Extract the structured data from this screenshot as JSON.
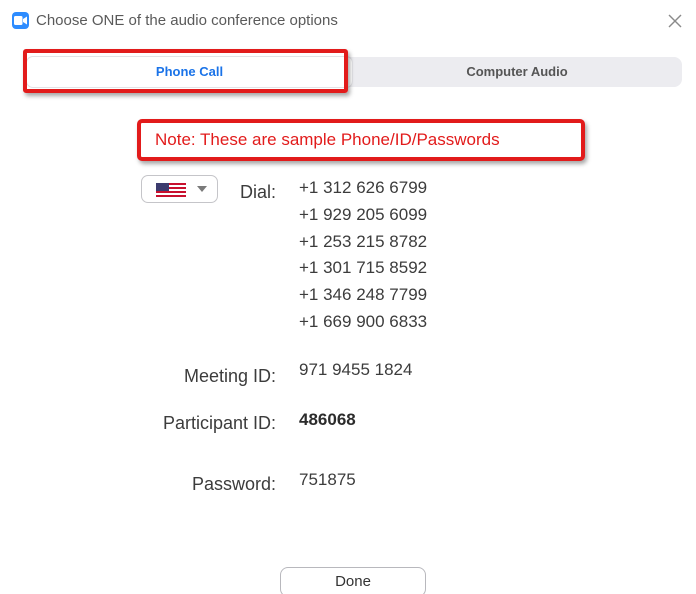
{
  "window": {
    "title": "Choose ONE of the audio conference options",
    "app_icon": "zoom-camera-icon",
    "close_icon": "close-icon"
  },
  "tabs": [
    {
      "label": "Phone Call",
      "selected": true
    },
    {
      "label": "Computer Audio",
      "selected": false
    }
  ],
  "note": {
    "text": "Note:  These are sample Phone/ID/Passwords",
    "color": "#e21b1b"
  },
  "dial": {
    "label": "Dial:",
    "country_flag": "us-flag-icon",
    "numbers": [
      "+1 312 626 6799",
      "+1 929 205 6099",
      "+1 253 215 8782",
      "+1 301 715 8592",
      "+1 346 248 7799",
      "+1 669 900 6833"
    ]
  },
  "meeting_id": {
    "label": "Meeting ID:",
    "value": "971 9455 1824"
  },
  "participant_id": {
    "label": "Participant ID:",
    "value": "486068"
  },
  "password": {
    "label": "Password:",
    "value": "751875"
  },
  "done_label": "Done",
  "colors": {
    "accent": "#1a73e8",
    "annotation_red": "#e21b1b",
    "zoom_blue": "#2d8cff"
  }
}
